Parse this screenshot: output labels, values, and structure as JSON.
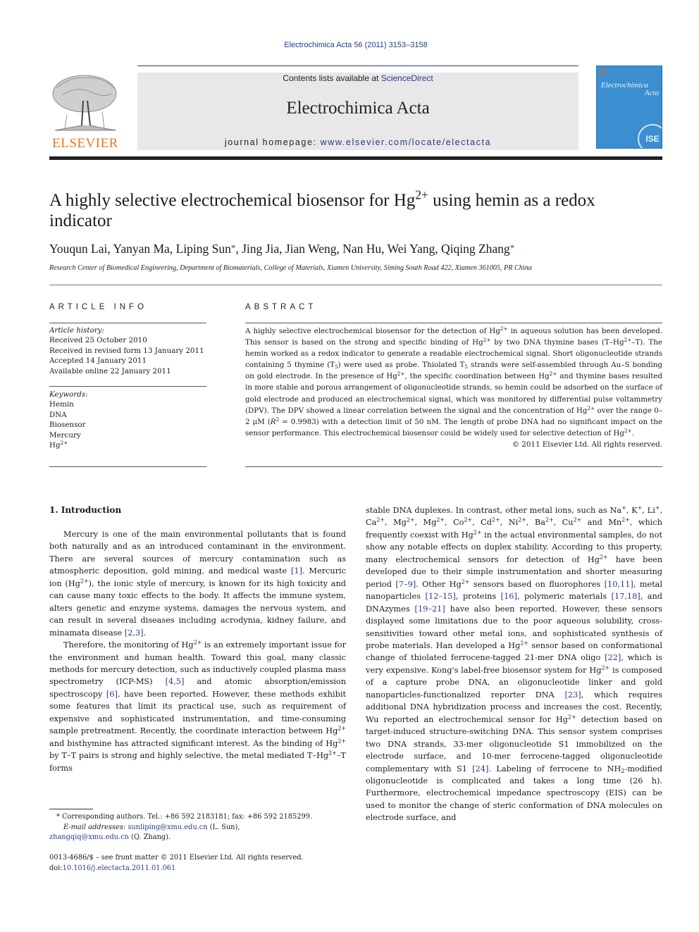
{
  "header": {
    "journal_citation": "Electrochimica Acta 56 (2011) 3153–3158",
    "contents_prefix": "Contents lists available at ",
    "contents_link": "ScienceDirect",
    "journal_title": "Electrochimica Acta",
    "homepage_prefix": "journal homepage: ",
    "homepage_url": "www.elsevier.com/locate/electacta",
    "publisher_logo_text": "ELSEVIER",
    "cover_title_line1": "Electrochimica",
    "cover_title_line2": "Acta",
    "cover_badge": "ISE"
  },
  "article": {
    "title_part1": "A highly selective electrochemical biosensor for Hg",
    "title_sup": "2+",
    "title_part2": " using hemin as a redox indicator",
    "authors": [
      {
        "name": "Youqun Lai",
        "corresponding": false
      },
      {
        "name": "Yanyan Ma",
        "corresponding": false
      },
      {
        "name": "Liping Sun",
        "corresponding": true
      },
      {
        "name": "Jing Jia",
        "corresponding": false
      },
      {
        "name": "Jian Weng",
        "corresponding": false
      },
      {
        "name": "Nan Hu",
        "corresponding": false
      },
      {
        "name": "Wei Yang",
        "corresponding": false
      },
      {
        "name": "Qiqing Zhang",
        "corresponding": true
      }
    ],
    "corresponding_mark": "*",
    "affiliation": "Research Center of Biomedical Engineering, Department of Biomaterials, College of Materials, Xiamen University, Siming South Road 422, Xiamen 361005, PR China"
  },
  "article_info": {
    "heading": "ARTICLE INFO",
    "history_label": "Article history:",
    "history": [
      "Received 25 October 2010",
      "Received in revised form 13 January 2011",
      "Accepted 14 January 2011",
      "Available online 22 January 2011"
    ],
    "keywords_label": "Keywords:",
    "keywords": [
      "Hemin",
      "DNA",
      "Biosensor",
      "Mercury"
    ],
    "keyword_last_base": "Hg",
    "keyword_last_sup": "2+"
  },
  "abstract": {
    "heading": "ABSTRACT",
    "copyright": "© 2011 Elsevier Ltd. All rights reserved."
  },
  "introduction": {
    "heading": "1.  Introduction"
  },
  "footnote": {
    "star": "*",
    "contact": " Corresponding authors. Tel.: +86 592 2183181; fax: +86 592 2185299.",
    "email_label": "E-mail addresses:",
    "email1": "sunliping@xmu.edu.cn",
    "email1_owner": " (L. Sun),",
    "email2": "zhangqiq@xmu.edu.cn",
    "email2_owner": " (Q. Zhang).",
    "issn_line": "0013-4686/$ – see front matter © 2011 Elsevier Ltd. All rights reserved.",
    "doi_prefix": "doi:",
    "doi": "10.1016/j.electacta.2011.01.061"
  }
}
